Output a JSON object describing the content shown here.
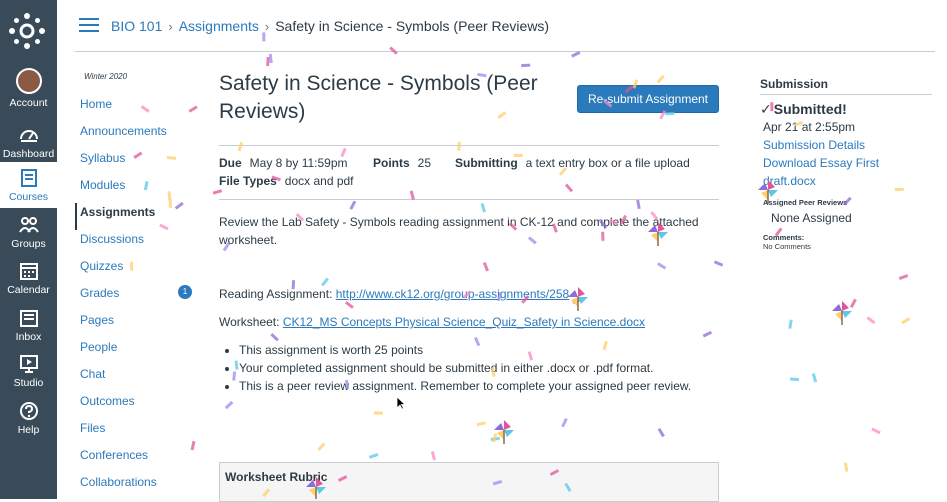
{
  "global_nav": {
    "items": [
      {
        "label": "Account",
        "icon": "account-avatar"
      },
      {
        "label": "Dashboard",
        "icon": "dashboard-icon"
      },
      {
        "label": "Courses",
        "icon": "courses-icon"
      },
      {
        "label": "Groups",
        "icon": "groups-icon"
      },
      {
        "label": "Calendar",
        "icon": "calendar-icon"
      },
      {
        "label": "Inbox",
        "icon": "inbox-icon"
      },
      {
        "label": "Studio",
        "icon": "studio-icon"
      },
      {
        "label": "Help",
        "icon": "help-icon"
      }
    ]
  },
  "breadcrumb": {
    "course": "BIO 101",
    "section": "Assignments",
    "current": "Safety in Science - Symbols (Peer Reviews)"
  },
  "course_nav": {
    "term": "Winter 2020",
    "items": [
      {
        "label": "Home"
      },
      {
        "label": "Announcements"
      },
      {
        "label": "Syllabus"
      },
      {
        "label": "Modules"
      },
      {
        "label": "Assignments"
      },
      {
        "label": "Discussions"
      },
      {
        "label": "Quizzes"
      },
      {
        "label": "Grades",
        "badge": "1"
      },
      {
        "label": "Pages"
      },
      {
        "label": "People"
      },
      {
        "label": "Chat"
      },
      {
        "label": "Outcomes"
      },
      {
        "label": "Files"
      },
      {
        "label": "Conferences"
      },
      {
        "label": "Collaborations"
      }
    ]
  },
  "assignment": {
    "title": "Safety in Science - Symbols (Peer Reviews)",
    "resubmit_label": "Re-submit Assignment",
    "due_label": "Due",
    "due_value": "May 8 by 11:59pm",
    "points_label": "Points",
    "points_value": "25",
    "submitting_label": "Submitting",
    "submitting_value": "a text entry box or a file upload",
    "file_types_label": "File Types",
    "file_types_value": "docx and pdf",
    "description": "Review the Lab Safety - Symbols reading assignment in CK-12 and complete the attached worksheet.",
    "reading_label": "Reading Assignment:",
    "reading_link": "http://www.ck12.org/group-assignments/258",
    "worksheet_label": "Worksheet:",
    "worksheet_link": "CK12_MS Concepts Physical Science_Quiz_Safety in Science.docx",
    "bullets": [
      "This assignment is worth 25 points",
      "Your completed assignment should be submitted in either .docx or .pdf format.",
      "This is a peer review assignment. Remember to complete your assigned peer review."
    ],
    "rubric_title": "Worksheet Rubric"
  },
  "submission": {
    "heading": "Submission",
    "status": "Submitted!",
    "date": "Apr 21 at 2:55pm",
    "details_link": "Submission Details",
    "download_link": "Download Essay First draft.docx",
    "peer_reviews_heading": "Assigned Peer Reviews",
    "peer_reviews_value": "None Assigned",
    "comments_heading": "Comments:",
    "comments_value": "No Comments"
  },
  "colors": {
    "nav_bg": "#394b58",
    "link": "#2b7abc",
    "text": "#2d3b45",
    "confetti": [
      "#e0559b",
      "#8f6ad8",
      "#ffcf6b",
      "#5bc8e8",
      "#ff8ac4",
      "#9b8af0"
    ]
  }
}
